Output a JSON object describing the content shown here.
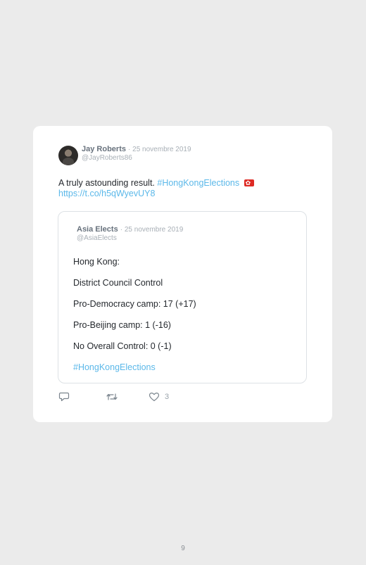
{
  "tweet": {
    "author": {
      "display_name": "Jay Roberts",
      "date": "· 25 novembre 2019",
      "handle": "@JayRoberts86"
    },
    "text": "A truly astounding result.",
    "hashtag": "#HongKongElections",
    "flag_icon": "hong-kong-flag",
    "url": "https://t.co/h5qWyevUY8"
  },
  "quoted_tweet": {
    "author": {
      "display_name": "Asia Elects",
      "date": "· 25 novembre 2019",
      "handle": "@AsiaElects"
    },
    "lines": [
      "Hong Kong:",
      "District Council Control",
      "Pro-Democracy camp: 17 (+17)",
      "Pro-Beijing camp: 1 (-16)",
      "No Overall Control: 0 (-1)"
    ],
    "hashtag": "#HongKongElections"
  },
  "actions": {
    "reply_icon": "reply-icon",
    "retweet_icon": "retweet-icon",
    "like_icon": "heart-icon",
    "like_count": "3"
  },
  "page_number": "9",
  "colors": {
    "background": "#ebebeb",
    "card": "#ffffff",
    "link": "#5bb8e9",
    "muted": "#a8afb6"
  }
}
